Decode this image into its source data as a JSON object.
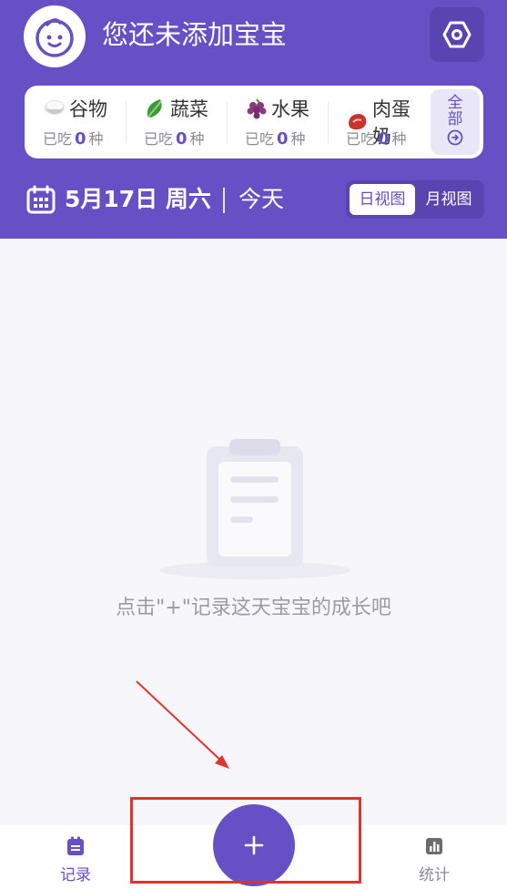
{
  "header": {
    "title": "您还未添加宝宝",
    "settings_icon": "settings-hexagon-icon"
  },
  "food_categories": [
    {
      "name": "谷物",
      "eaten_prefix": "已吃",
      "count": "0",
      "unit": "种",
      "icon": "rice-bowl-icon"
    },
    {
      "name": "蔬菜",
      "eaten_prefix": "已吃",
      "count": "0",
      "unit": "种",
      "icon": "leafy-green-icon"
    },
    {
      "name": "水果",
      "eaten_prefix": "已吃",
      "count": "0",
      "unit": "种",
      "icon": "grapes-icon"
    },
    {
      "name": "肉蛋奶",
      "eaten_prefix": "已吃",
      "count": "0",
      "unit": "种",
      "icon": "meat-icon"
    }
  ],
  "all_button": {
    "line1": "全",
    "line2": "部"
  },
  "date_bar": {
    "date": "5月17日 周六",
    "today": "今天",
    "views": {
      "day": "日视图",
      "month": "月视图"
    }
  },
  "empty_state": {
    "text": "点击\"+\"记录这天宝宝的成长吧"
  },
  "tabbar": {
    "record": "记录",
    "stats": "统计"
  },
  "colors": {
    "primary": "#6550c5",
    "annotation": "#e0332f"
  }
}
